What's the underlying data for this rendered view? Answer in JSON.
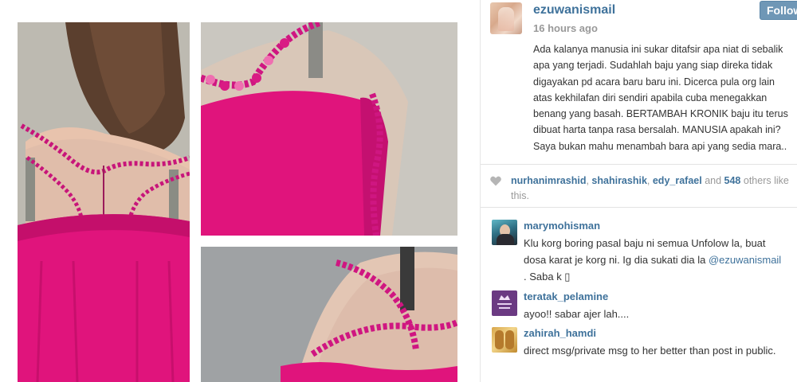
{
  "post": {
    "username": "ezuwanismail",
    "time_ago": "16 hours ago",
    "follow_label": "Follow",
    "caption": "Ada kalanya manusia ini sukar ditafsir apa niat di sebalik apa yang terjadi. Sudahlah baju yang siap direka tidak digayakan pd acara baru baru ini. Dicerca pula org lain atas kekhilafan diri sendiri apabila cuba menegakkan benang yang basah. BERTAMBAH KRONIK baju itu terus dibuat harta tanpa rasa bersalah. MANUSIA apakah ini? Saya bukan mahu menambah bara api yang sedia mara.."
  },
  "likes": {
    "icon": "heart-icon",
    "likers": [
      "nurhanimrashid",
      "shahirashik",
      "edy_rafael"
    ],
    "separator": ", ",
    "and_word": " and ",
    "count": "548",
    "suffix": " others like this."
  },
  "comments": [
    {
      "username": "marymohisman",
      "text_before": "Klu korg boring pasal baju ni semua Unfolow la, buat dosa karat je korg ni. Ig dia sukati dia la ",
      "mention": "@ezuwanismail",
      "text_after": " . Saba k ▯"
    },
    {
      "username": "teratak_pelamine",
      "text": "ayoo!! sabar ajer lah...."
    },
    {
      "username": "zahirah_hamdi",
      "text": "direct msg/private msg to her better than post in public."
    }
  ],
  "colors": {
    "link_blue": "#3f729b",
    "dress_pink": "#e0147c",
    "follow_button": "#6f97b6"
  }
}
